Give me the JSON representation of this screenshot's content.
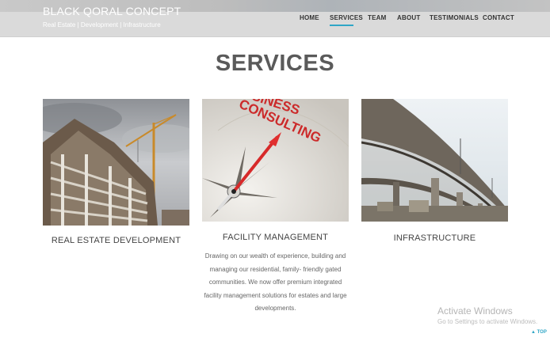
{
  "header": {
    "brand": "BLACK QORAL CONCEPT",
    "tagline": "Real Estate | Development | Infrastructure",
    "menu": [
      "HOME",
      "SERVICES",
      "TEAM",
      "ABOUT",
      "TESTIMONIALS",
      "CONTACT"
    ],
    "active_item": "SERVICES",
    "accent_color": "#2fa6c6"
  },
  "section": {
    "title": "SERVICES"
  },
  "cards": [
    {
      "title": "REAL ESTATE DEVELOPMENT",
      "image": "construction-site-crane"
    },
    {
      "title": "FACILITY MANAGEMENT",
      "image": "business-consulting-compass",
      "image_text": "BUSINESS CONSULTING",
      "description": [
        "Drawing on our wealth of experience, building and",
        "managing our residential, family- friendly gated",
        "communities. We now offer premium integrated",
        "facility management solutions for estates and large",
        "developments."
      ]
    },
    {
      "title": "INFRASTRUCTURE",
      "image": "highway-overpass"
    }
  ],
  "watermark": {
    "title": "Activate Windows",
    "subtitle": "Go to Settings to activate Windows."
  },
  "back_to_top": {
    "label": "TOP"
  }
}
